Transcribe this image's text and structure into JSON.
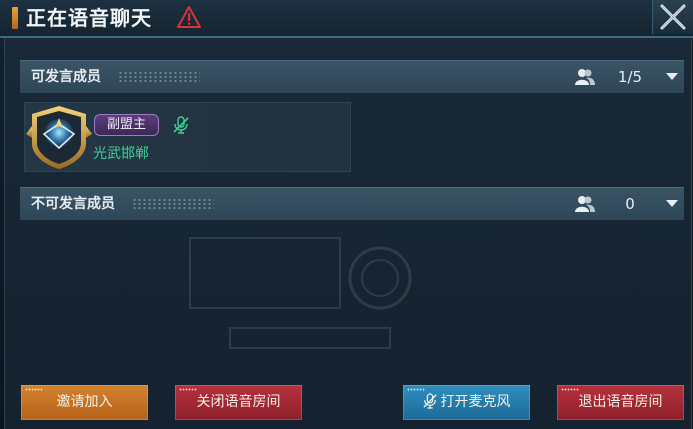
{
  "window": {
    "title": "正在语音聊天",
    "close_icon": "close-icon",
    "warning_icon": "warning-icon"
  },
  "sections": [
    {
      "label": "可发言成员",
      "count": "1/5",
      "icon": "people-icon",
      "members": [
        {
          "role": "副盟主",
          "name": "光武邯郸",
          "mic": "mic-off-icon",
          "avatar": "emblem-avatar"
        }
      ]
    },
    {
      "label": "不可发言成员",
      "count": "0",
      "icon": "people-icon",
      "members": []
    }
  ],
  "buttons": {
    "invite": "邀请加入",
    "close_room": "关闭语音房间",
    "open_mic": "打开麦克风",
    "exit_room": "退出语音房间"
  },
  "colors": {
    "accent_gold": "#e6a43a",
    "name_green": "#3ed09a",
    "role_purple": "#5a3e7a",
    "btn_orange": "#c8732a",
    "btn_red": "#a42834",
    "btn_blue": "#267cab"
  }
}
